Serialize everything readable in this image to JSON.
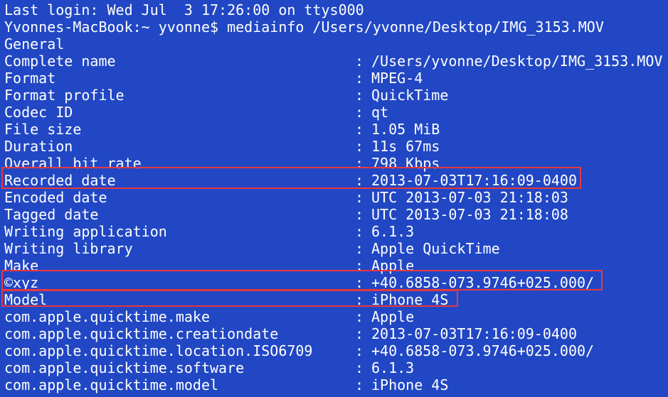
{
  "terminal": {
    "last_login": "Last login: Wed Jul  3 17:26:00 on ttys000",
    "prompt": "Yvonnes-MacBook:~ yvonne$ mediainfo /Users/yvonne/Desktop/IMG_3153.MOV",
    "section": "General",
    "separator": ":",
    "fields": [
      {
        "key": "Complete name",
        "value": "/Users/yvonne/Desktop/IMG_3153.MOV"
      },
      {
        "key": "Format",
        "value": "MPEG-4"
      },
      {
        "key": "Format profile",
        "value": "QuickTime"
      },
      {
        "key": "Codec ID",
        "value": "qt"
      },
      {
        "key": "File size",
        "value": "1.05 MiB"
      },
      {
        "key": "Duration",
        "value": "11s 67ms"
      },
      {
        "key": "Overall bit rate",
        "value": "798 Kbps"
      },
      {
        "key": "Recorded date",
        "value": "2013-07-03T17:16:09-0400"
      },
      {
        "key": "Encoded date",
        "value": "UTC 2013-07-03 21:18:03"
      },
      {
        "key": "Tagged date",
        "value": "UTC 2013-07-03 21:18:08"
      },
      {
        "key": "Writing application",
        "value": "6.1.3"
      },
      {
        "key": "Writing library",
        "value": "Apple QuickTime"
      },
      {
        "key": "Make",
        "value": "Apple"
      },
      {
        "key": "©xyz",
        "value": "+40.6858-073.9746+025.000/"
      },
      {
        "key": "Model",
        "value": "iPhone 4S"
      },
      {
        "key": "com.apple.quicktime.make",
        "value": "Apple"
      },
      {
        "key": "com.apple.quicktime.creationdate",
        "value": "2013-07-03T17:16:09-0400"
      },
      {
        "key": "com.apple.quicktime.location.ISO6709",
        "value": "+40.6858-073.9746+025.000/"
      },
      {
        "key": "com.apple.quicktime.software",
        "value": "6.1.3"
      },
      {
        "key": "com.apple.quicktime.model",
        "value": "iPhone 4S"
      }
    ]
  },
  "colors": {
    "background": "#2147c4",
    "text": "#ffffff",
    "highlight": "#e8383d"
  }
}
